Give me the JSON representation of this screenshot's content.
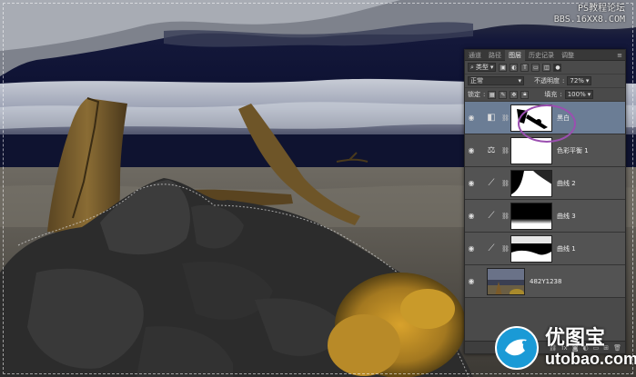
{
  "watermark_top": {
    "line1": "PS教程论坛",
    "line2": "BBS.16XX8.COM"
  },
  "panel": {
    "tabs": [
      "通道",
      "路径",
      "图层",
      "历史记录",
      "调整"
    ],
    "active_tab": "图层",
    "filter_label": "类型",
    "blend_mode": "正常",
    "opacity_label": "不透明度",
    "opacity_value": "72%",
    "lock_label": "锁定",
    "fill_label": "填充",
    "fill_value": "100%",
    "layers": [
      {
        "name": "黑白",
        "type": "black-white-adjustment",
        "selected": true
      },
      {
        "name": "色彩平衡 1",
        "type": "color-balance-adjustment",
        "selected": false
      },
      {
        "name": "曲线 2",
        "type": "curves-adjustment",
        "selected": false
      },
      {
        "name": "曲线 3",
        "type": "curves-adjustment",
        "selected": false
      },
      {
        "name": "曲线 1",
        "type": "curves-adjustment",
        "selected": false
      },
      {
        "name": "482Y1238",
        "type": "image-layer",
        "selected": false
      }
    ],
    "bottom_icons": [
      "link-icon",
      "fx-icon",
      "mask-icon",
      "adjustment-icon",
      "folder-icon",
      "new-layer-icon",
      "trash-icon"
    ]
  },
  "brand": {
    "name": "优图宝",
    "url": "utobao.com"
  },
  "colors": {
    "selected_layer": "#6b7d95",
    "panel_bg": "#4a4a4a",
    "highlight_ring": "#9b4fb0",
    "brand_blue": "#1a9ad6"
  }
}
